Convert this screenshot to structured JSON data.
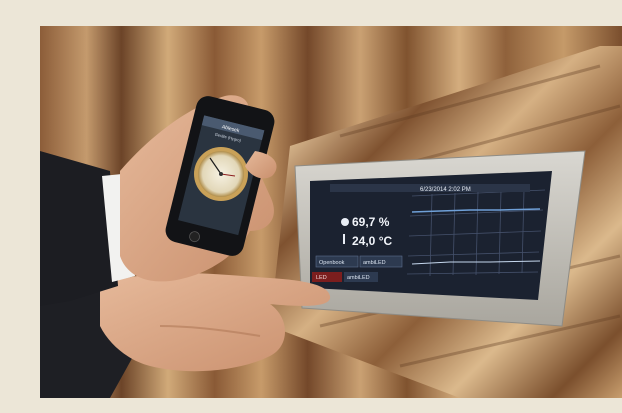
{
  "scene": {
    "subject": "Hand holding smartphone with hygrometer app next to wall-mounted touch panel"
  },
  "panel": {
    "datetime": "6/23/2014 2:02 PM",
    "humidity": "69,7 %",
    "temperature": "24,0 °C",
    "btn_left": "Openbook",
    "btn_right": "ambiLED",
    "bottom_left": "LED",
    "bottom_mid": "ambiLED"
  },
  "phone": {
    "title": "Ablesek",
    "subtitle": "Geräte (Hygro)"
  },
  "colors": {
    "background": "#ece6d7",
    "wood_dark": "#7a5232",
    "wood_light": "#c99d6c",
    "panel_frame": "#bdbab3",
    "screen": "#1b2230",
    "graph_line": "#6fa0d8"
  }
}
